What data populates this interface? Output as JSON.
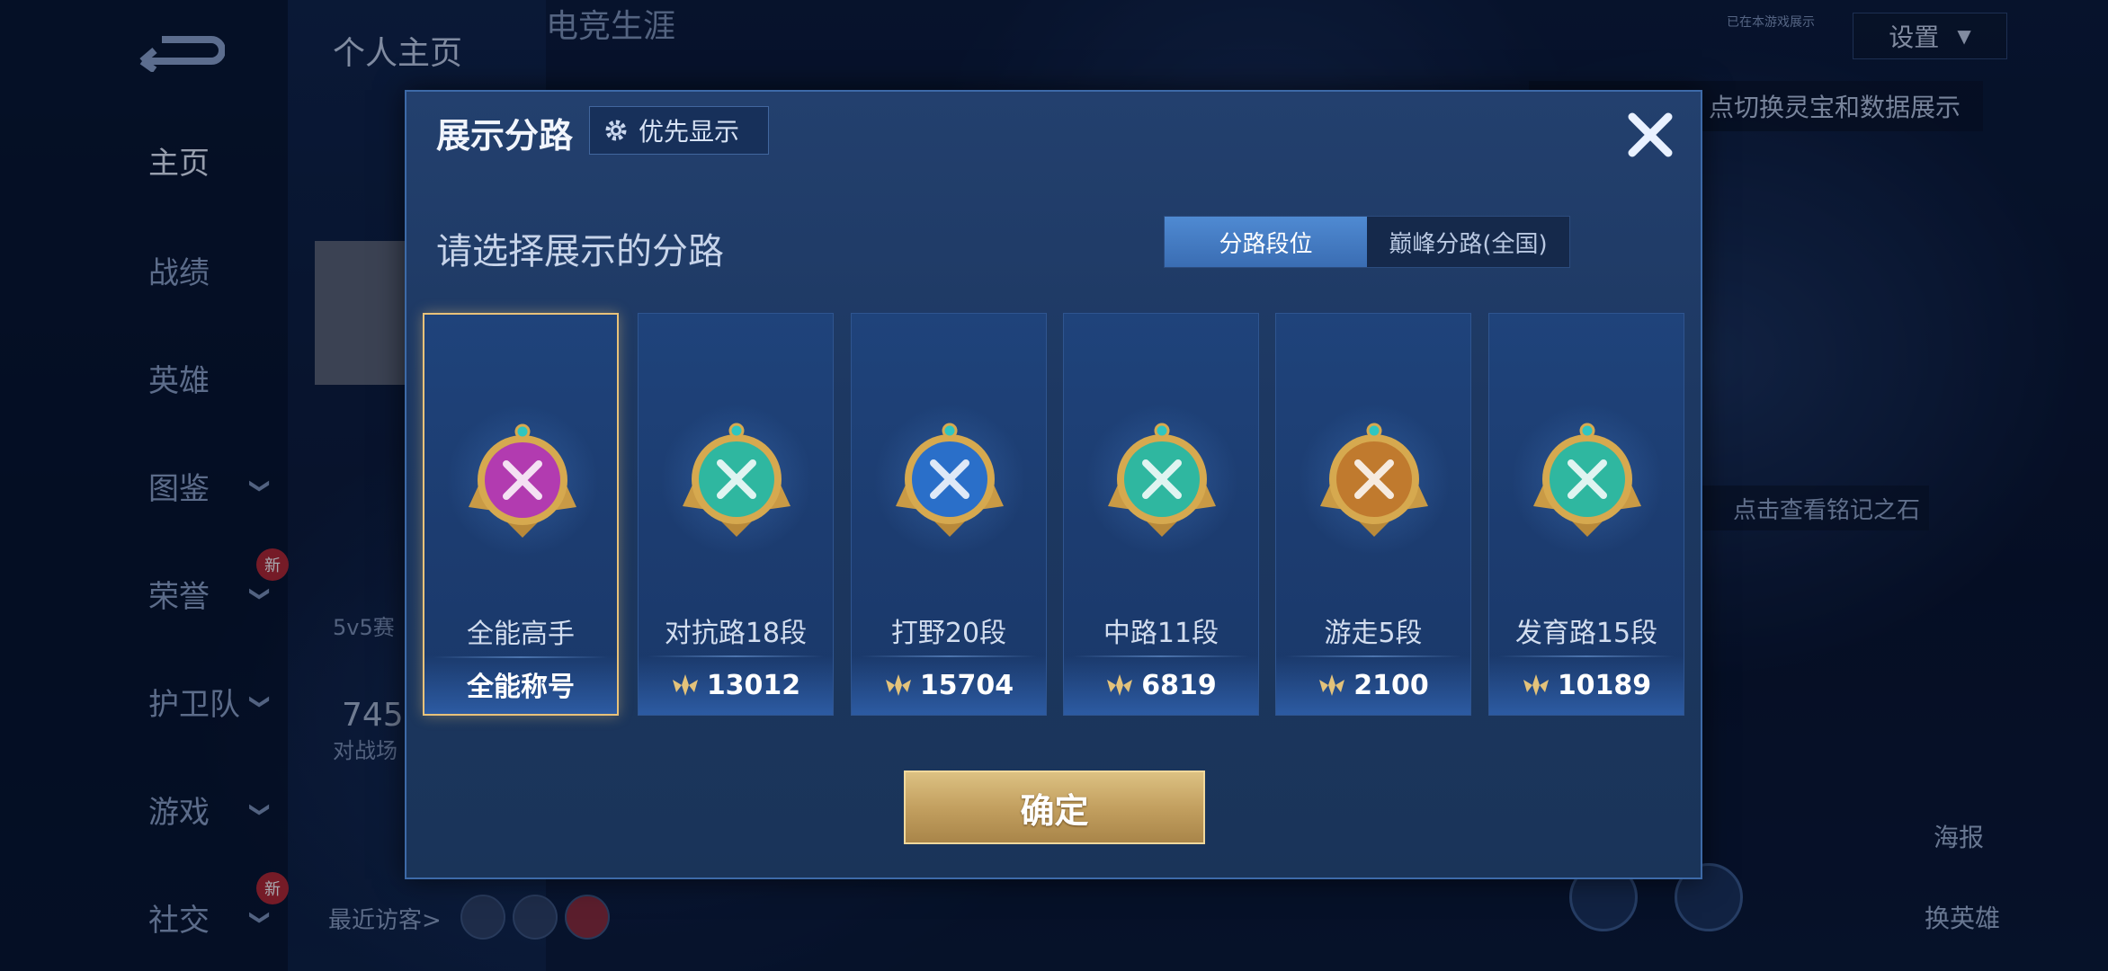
{
  "sidebar": {
    "items": [
      {
        "label": "主页",
        "chevron": false,
        "new": false
      },
      {
        "label": "战绩",
        "chevron": false,
        "new": false
      },
      {
        "label": "英雄",
        "chevron": false,
        "new": false
      },
      {
        "label": "图鉴",
        "chevron": true,
        "new": false
      },
      {
        "label": "荣誉",
        "chevron": true,
        "new": true
      },
      {
        "label": "护卫队",
        "chevron": true,
        "new": false
      },
      {
        "label": "游戏",
        "chevron": true,
        "new": false
      },
      {
        "label": "社交",
        "chevron": true,
        "new": true
      }
    ],
    "new_badge": "新"
  },
  "top": {
    "tabs": [
      "个人主页",
      "电竞生涯"
    ],
    "settings_label": "设置",
    "small_note": "已在本游戏展示",
    "hint": "点切换灵宝和数据展示",
    "rune_hint": "点击查看铭记之石",
    "poster": "海报",
    "switch_hero": "换英雄",
    "recent_visitors": "最近访客>",
    "mode_label": "5v5赛",
    "stat_num": "745",
    "stat_label": "对战场"
  },
  "modal": {
    "title": "展示分路",
    "priority_label": "优先显示",
    "subtitle": "请选择展示的分路",
    "toggle": {
      "active": "分路段位",
      "inactive": "巅峰分路(全国)"
    },
    "cards": [
      {
        "name": "全能高手",
        "foot": "全能称号",
        "points": null,
        "color": "#b23bb0",
        "selected": true
      },
      {
        "name": "对抗路18段",
        "foot": "13012",
        "points": true,
        "color": "#2fb7a0",
        "selected": false
      },
      {
        "name": "打野20段",
        "foot": "15704",
        "points": true,
        "color": "#2a6fc9",
        "selected": false
      },
      {
        "name": "中路11段",
        "foot": "6819",
        "points": true,
        "color": "#2fb7a0",
        "selected": false
      },
      {
        "name": "游走5段",
        "foot": "2100",
        "points": true,
        "color": "#c07a2e",
        "selected": false
      },
      {
        "name": "发育路15段",
        "foot": "10189",
        "points": true,
        "color": "#2fb7a0",
        "selected": false
      }
    ],
    "confirm_label": "确定"
  },
  "colors": {
    "accent_gold": "#e8c27a",
    "active_tab": "#4f8ad2",
    "panel": "#1d3862"
  }
}
